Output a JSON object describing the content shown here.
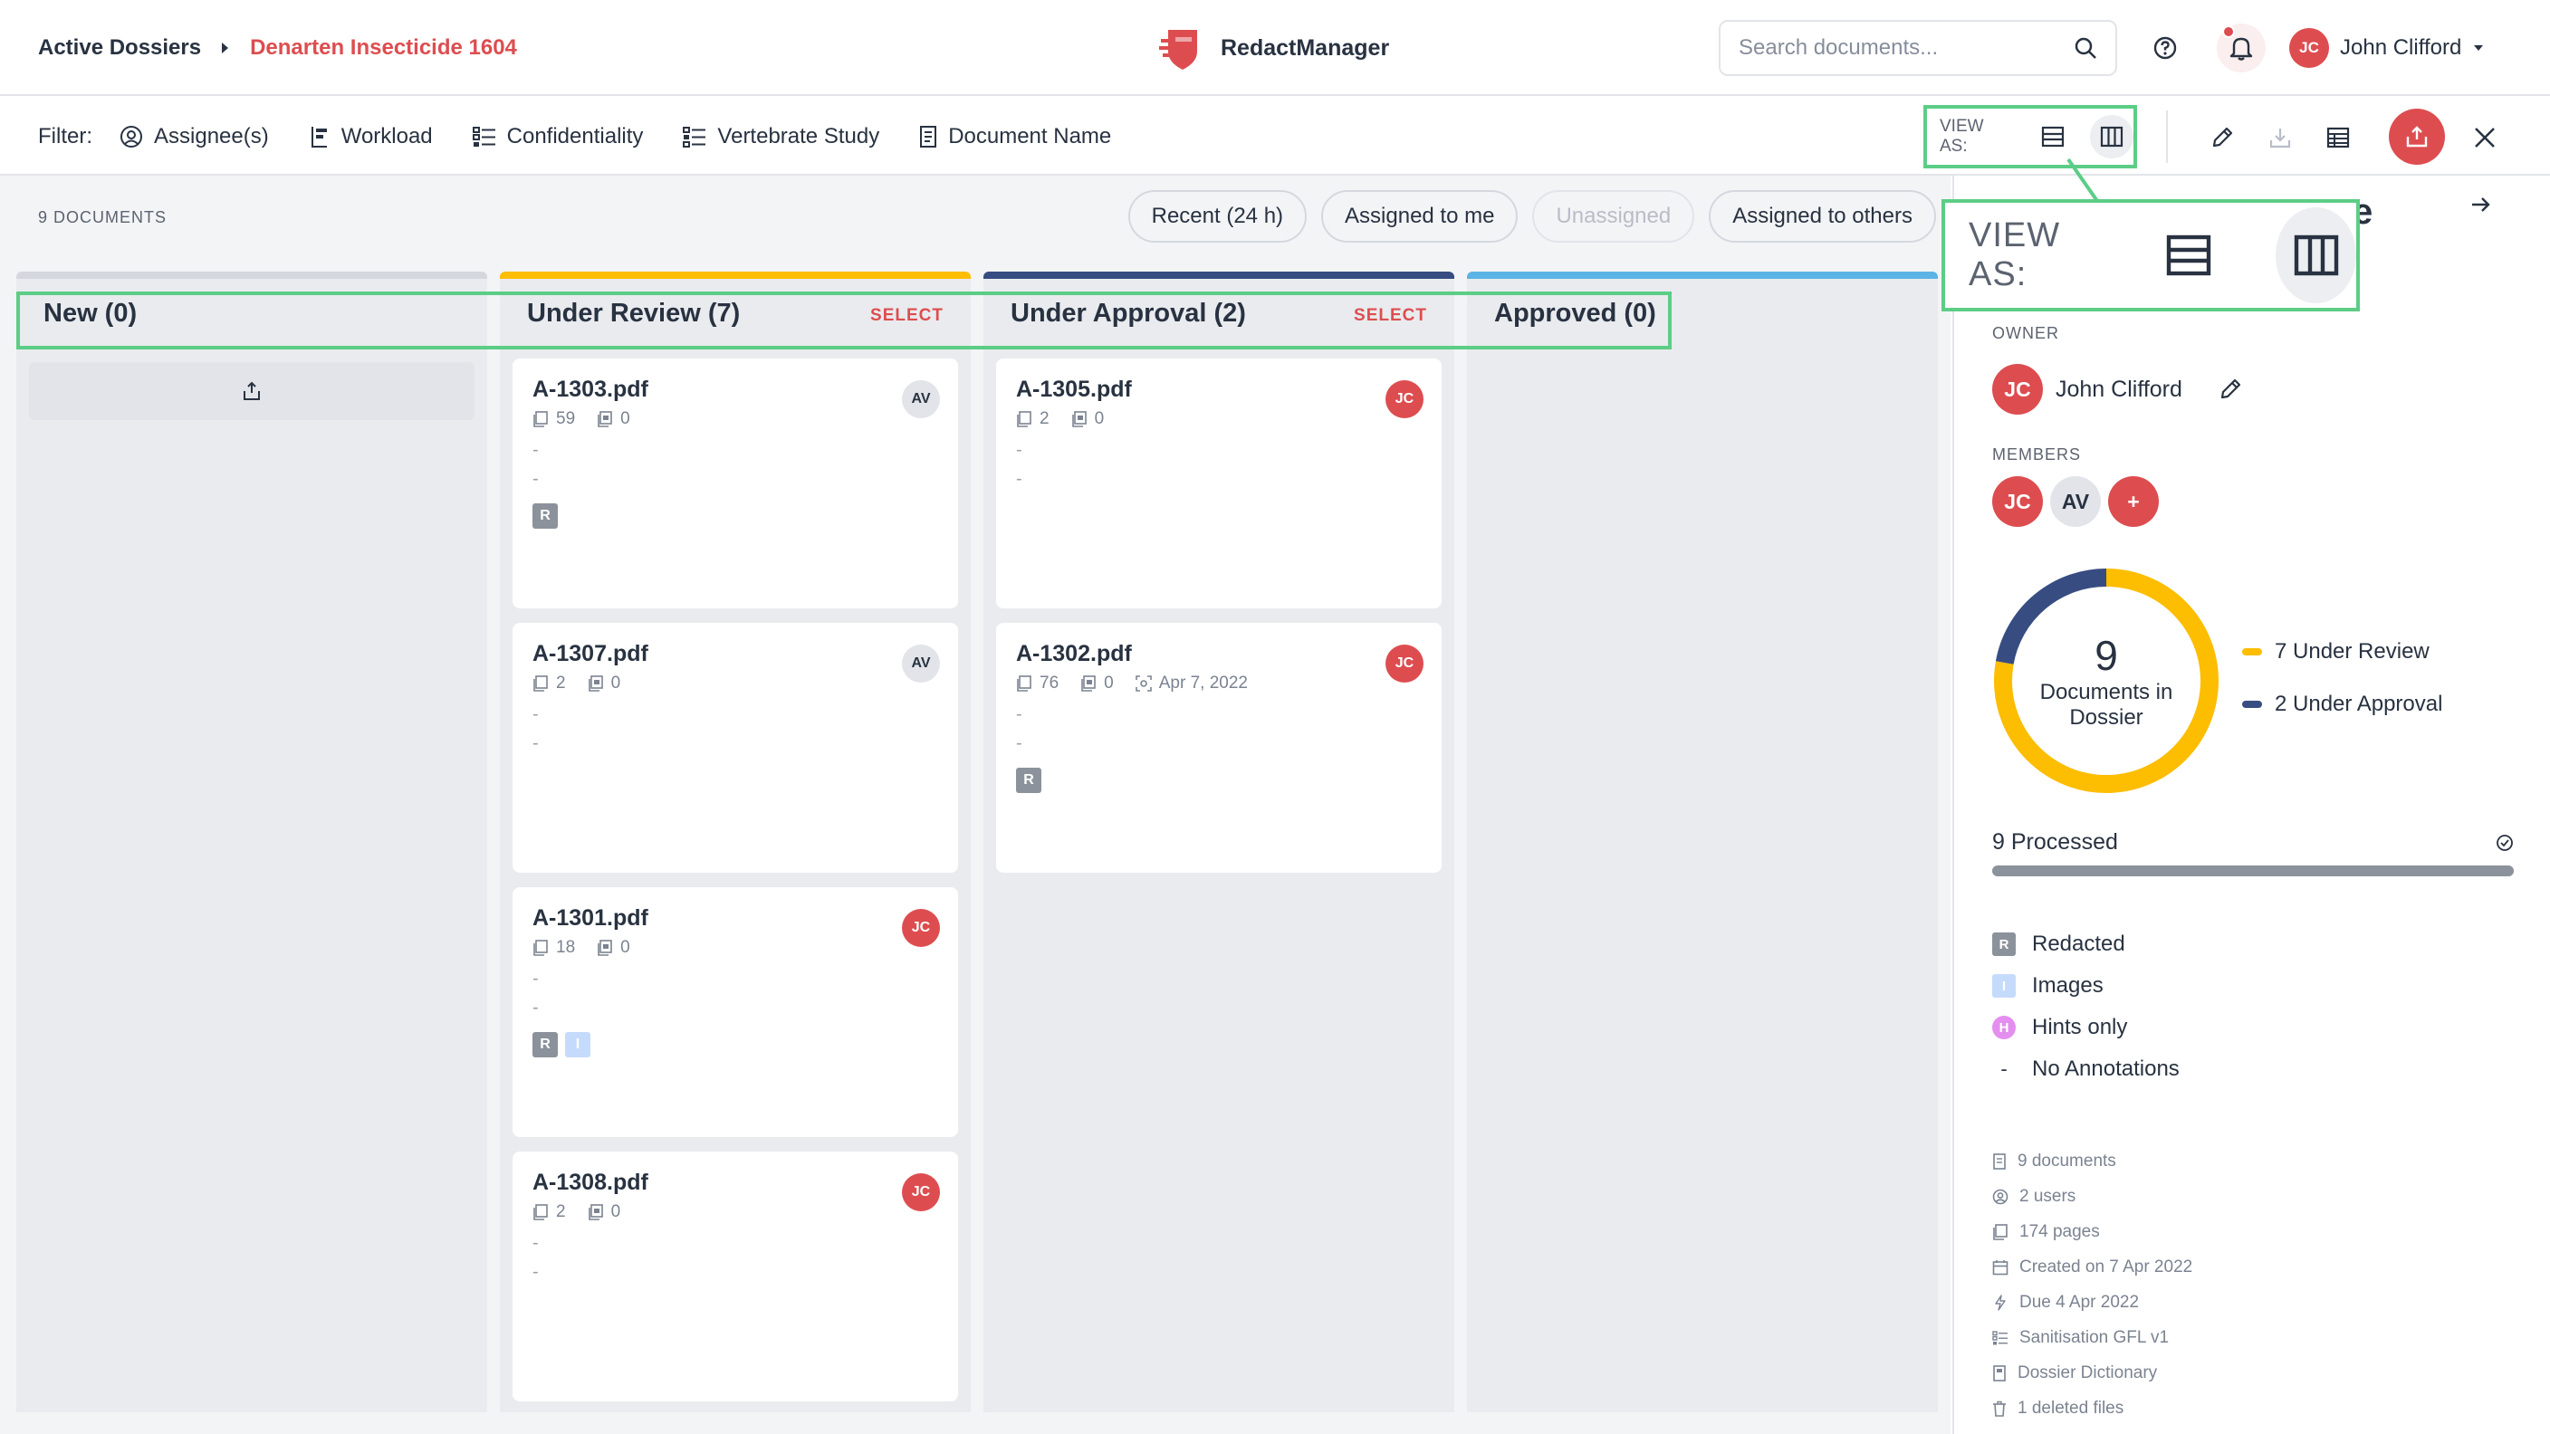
{
  "breadcrumb": {
    "root": "Active Dossiers",
    "current": "Denarten Insecticide 1604"
  },
  "app": {
    "name": "RedactManager"
  },
  "search": {
    "placeholder": "Search documents..."
  },
  "user": {
    "initials": "JC",
    "name": "John Clifford"
  },
  "filters": {
    "label": "Filter:",
    "items": [
      "Assignee(s)",
      "Workload",
      "Confidentiality",
      "Vertebrate Study",
      "Document Name"
    ]
  },
  "view_as": {
    "label": "VIEW AS:",
    "options": [
      "list",
      "board"
    ],
    "active": "board"
  },
  "board": {
    "doc_count": "9 DOCUMENTS",
    "quick_filters": [
      {
        "label": "Recent (24 h)",
        "enabled": true
      },
      {
        "label": "Assigned to me",
        "enabled": true
      },
      {
        "label": "Unassigned",
        "enabled": false
      },
      {
        "label": "Assigned to others",
        "enabled": true
      }
    ],
    "select_label": "SELECT",
    "columns": [
      {
        "title": "New (0)",
        "color": "#d4d8de"
      },
      {
        "title": "Under Review (7)",
        "color": "#fdbd00"
      },
      {
        "title": "Under Approval (2)",
        "color": "#374c81"
      },
      {
        "title": "Approved (0)",
        "color": "#5bb4e5"
      }
    ],
    "under_review": [
      {
        "name": "A-1303.pdf",
        "pages": "59",
        "annotations": "0",
        "assignee": "AV",
        "tags": [
          "R"
        ]
      },
      {
        "name": "A-1307.pdf",
        "pages": "2",
        "annotations": "0",
        "assignee": "AV",
        "tags": []
      },
      {
        "name": "A-1301.pdf",
        "pages": "18",
        "annotations": "0",
        "assignee": "JC",
        "tags": [
          "R",
          "I"
        ]
      },
      {
        "name": "A-1308.pdf",
        "pages": "2",
        "annotations": "0",
        "assignee": "JC",
        "tags": []
      }
    ],
    "under_approval": [
      {
        "name": "A-1305.pdf",
        "pages": "2",
        "annotations": "0",
        "assignee": "JC",
        "tags": []
      },
      {
        "name": "A-1302.pdf",
        "pages": "76",
        "annotations": "0",
        "date": "Apr 7, 2022",
        "assignee": "JC",
        "tags": [
          "R"
        ]
      }
    ],
    "dash": "-"
  },
  "panel": {
    "title_tail": "e",
    "owner_label": "OWNER",
    "owner": {
      "initials": "JC",
      "name": "John Clifford"
    },
    "members_label": "MEMBERS",
    "members": [
      "JC",
      "AV"
    ],
    "add_member": "+",
    "donut": {
      "total": "9",
      "caption": "Documents in Dossier",
      "segments": [
        {
          "label": "7 Under Review",
          "value": 7,
          "color": "#fdbd00"
        },
        {
          "label": "2 Under Approval",
          "value": 2,
          "color": "#374c81"
        }
      ]
    },
    "processed": {
      "label": "9 Processed",
      "fraction": 1.0
    },
    "annotation_legend": [
      {
        "symbol": "R",
        "label": "Redacted",
        "color": "#8c929c"
      },
      {
        "symbol": "I",
        "label": "Images",
        "color": "#c5dbfb"
      },
      {
        "symbol": "H",
        "label": "Hints only",
        "color": "#e48ef0"
      },
      {
        "symbol": "-",
        "label": "No Annotations",
        "color": ""
      }
    ],
    "stats": [
      {
        "icon": "document-icon",
        "text": "9 documents"
      },
      {
        "icon": "user-icon",
        "text": "2 users"
      },
      {
        "icon": "pages-icon",
        "text": "174 pages"
      },
      {
        "icon": "calendar-icon",
        "text": "Created on 7 Apr 2022"
      },
      {
        "icon": "lightning-icon",
        "text": "Due 4 Apr 2022"
      },
      {
        "icon": "template-icon",
        "text": "Sanitisation GFL v1"
      },
      {
        "icon": "dictionary-icon",
        "text": "Dossier Dictionary"
      },
      {
        "icon": "trash-icon",
        "text": "1 deleted files"
      }
    ]
  },
  "colors": {
    "accent": "#dd4d50",
    "highlight": "#5ccd86"
  }
}
